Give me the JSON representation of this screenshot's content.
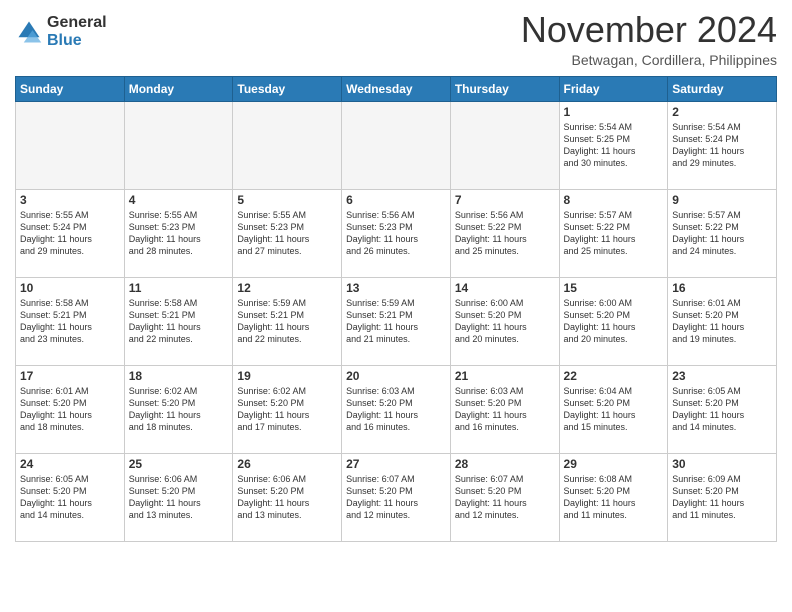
{
  "logo": {
    "general": "General",
    "blue": "Blue"
  },
  "title": "November 2024",
  "location": "Betwagan, Cordillera, Philippines",
  "weekdays": [
    "Sunday",
    "Monday",
    "Tuesday",
    "Wednesday",
    "Thursday",
    "Friday",
    "Saturday"
  ],
  "weeks": [
    [
      {
        "day": "",
        "info": ""
      },
      {
        "day": "",
        "info": ""
      },
      {
        "day": "",
        "info": ""
      },
      {
        "day": "",
        "info": ""
      },
      {
        "day": "",
        "info": ""
      },
      {
        "day": "1",
        "info": "Sunrise: 5:54 AM\nSunset: 5:25 PM\nDaylight: 11 hours\nand 30 minutes."
      },
      {
        "day": "2",
        "info": "Sunrise: 5:54 AM\nSunset: 5:24 PM\nDaylight: 11 hours\nand 29 minutes."
      }
    ],
    [
      {
        "day": "3",
        "info": "Sunrise: 5:55 AM\nSunset: 5:24 PM\nDaylight: 11 hours\nand 29 minutes."
      },
      {
        "day": "4",
        "info": "Sunrise: 5:55 AM\nSunset: 5:23 PM\nDaylight: 11 hours\nand 28 minutes."
      },
      {
        "day": "5",
        "info": "Sunrise: 5:55 AM\nSunset: 5:23 PM\nDaylight: 11 hours\nand 27 minutes."
      },
      {
        "day": "6",
        "info": "Sunrise: 5:56 AM\nSunset: 5:23 PM\nDaylight: 11 hours\nand 26 minutes."
      },
      {
        "day": "7",
        "info": "Sunrise: 5:56 AM\nSunset: 5:22 PM\nDaylight: 11 hours\nand 25 minutes."
      },
      {
        "day": "8",
        "info": "Sunrise: 5:57 AM\nSunset: 5:22 PM\nDaylight: 11 hours\nand 25 minutes."
      },
      {
        "day": "9",
        "info": "Sunrise: 5:57 AM\nSunset: 5:22 PM\nDaylight: 11 hours\nand 24 minutes."
      }
    ],
    [
      {
        "day": "10",
        "info": "Sunrise: 5:58 AM\nSunset: 5:21 PM\nDaylight: 11 hours\nand 23 minutes."
      },
      {
        "day": "11",
        "info": "Sunrise: 5:58 AM\nSunset: 5:21 PM\nDaylight: 11 hours\nand 22 minutes."
      },
      {
        "day": "12",
        "info": "Sunrise: 5:59 AM\nSunset: 5:21 PM\nDaylight: 11 hours\nand 22 minutes."
      },
      {
        "day": "13",
        "info": "Sunrise: 5:59 AM\nSunset: 5:21 PM\nDaylight: 11 hours\nand 21 minutes."
      },
      {
        "day": "14",
        "info": "Sunrise: 6:00 AM\nSunset: 5:20 PM\nDaylight: 11 hours\nand 20 minutes."
      },
      {
        "day": "15",
        "info": "Sunrise: 6:00 AM\nSunset: 5:20 PM\nDaylight: 11 hours\nand 20 minutes."
      },
      {
        "day": "16",
        "info": "Sunrise: 6:01 AM\nSunset: 5:20 PM\nDaylight: 11 hours\nand 19 minutes."
      }
    ],
    [
      {
        "day": "17",
        "info": "Sunrise: 6:01 AM\nSunset: 5:20 PM\nDaylight: 11 hours\nand 18 minutes."
      },
      {
        "day": "18",
        "info": "Sunrise: 6:02 AM\nSunset: 5:20 PM\nDaylight: 11 hours\nand 18 minutes."
      },
      {
        "day": "19",
        "info": "Sunrise: 6:02 AM\nSunset: 5:20 PM\nDaylight: 11 hours\nand 17 minutes."
      },
      {
        "day": "20",
        "info": "Sunrise: 6:03 AM\nSunset: 5:20 PM\nDaylight: 11 hours\nand 16 minutes."
      },
      {
        "day": "21",
        "info": "Sunrise: 6:03 AM\nSunset: 5:20 PM\nDaylight: 11 hours\nand 16 minutes."
      },
      {
        "day": "22",
        "info": "Sunrise: 6:04 AM\nSunset: 5:20 PM\nDaylight: 11 hours\nand 15 minutes."
      },
      {
        "day": "23",
        "info": "Sunrise: 6:05 AM\nSunset: 5:20 PM\nDaylight: 11 hours\nand 14 minutes."
      }
    ],
    [
      {
        "day": "24",
        "info": "Sunrise: 6:05 AM\nSunset: 5:20 PM\nDaylight: 11 hours\nand 14 minutes."
      },
      {
        "day": "25",
        "info": "Sunrise: 6:06 AM\nSunset: 5:20 PM\nDaylight: 11 hours\nand 13 minutes."
      },
      {
        "day": "26",
        "info": "Sunrise: 6:06 AM\nSunset: 5:20 PM\nDaylight: 11 hours\nand 13 minutes."
      },
      {
        "day": "27",
        "info": "Sunrise: 6:07 AM\nSunset: 5:20 PM\nDaylight: 11 hours\nand 12 minutes."
      },
      {
        "day": "28",
        "info": "Sunrise: 6:07 AM\nSunset: 5:20 PM\nDaylight: 11 hours\nand 12 minutes."
      },
      {
        "day": "29",
        "info": "Sunrise: 6:08 AM\nSunset: 5:20 PM\nDaylight: 11 hours\nand 11 minutes."
      },
      {
        "day": "30",
        "info": "Sunrise: 6:09 AM\nSunset: 5:20 PM\nDaylight: 11 hours\nand 11 minutes."
      }
    ]
  ]
}
